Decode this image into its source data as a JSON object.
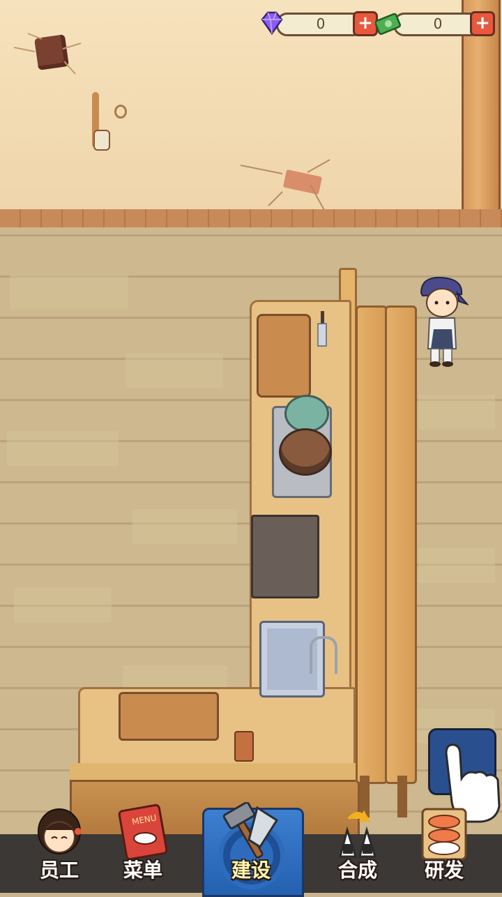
{
  "currency": {
    "gems": {
      "value": "0",
      "icon": "gem-icon",
      "color": "#8b5cf6"
    },
    "cash": {
      "value": "0",
      "icon": "cash-icon",
      "color": "#4caf50"
    },
    "add_icon": "plus-icon"
  },
  "nav": {
    "items": [
      {
        "label": "员工",
        "icon": "staff-icon"
      },
      {
        "label": "菜单",
        "icon": "menu-book-icon"
      },
      {
        "label": "建设",
        "icon": "build-tools-icon",
        "active": true
      },
      {
        "label": "合成",
        "icon": "merge-icon"
      },
      {
        "label": "研发",
        "icon": "research-sushi-icon"
      }
    ]
  },
  "colors": {
    "nav_bar": "#3c3836",
    "nav_active": "#2d6cbd",
    "plus_button": "#e8583c"
  }
}
